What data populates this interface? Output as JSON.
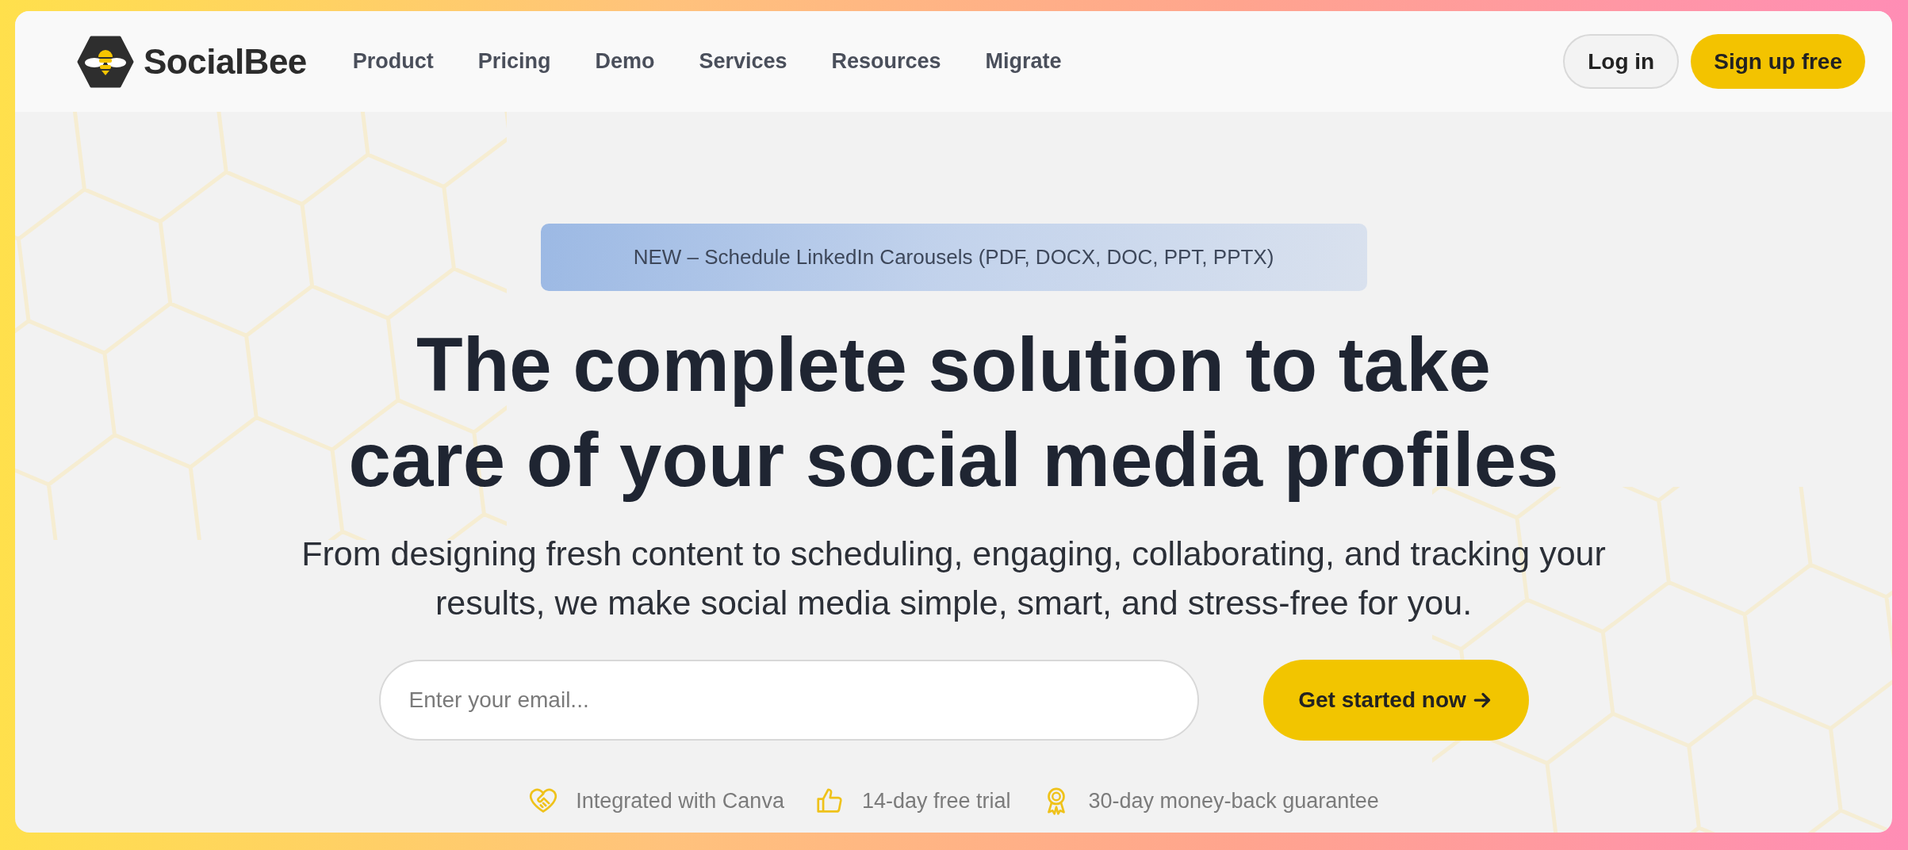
{
  "header": {
    "brand": "SocialBee",
    "nav": [
      "Product",
      "Pricing",
      "Demo",
      "Services",
      "Resources",
      "Migrate"
    ],
    "buttons": [
      {
        "label": "Log in",
        "kind": "secondary"
      },
      {
        "label": "Sign up free",
        "kind": "primary"
      }
    ]
  },
  "hero": {
    "badge": "NEW – Schedule LinkedIn Carousels (PDF, DOCX, DOC, PPT, PPTX)",
    "title": "The complete solution to take care of your social media profiles",
    "subtitle": "From designing fresh content to scheduling, engaging, collaborating, and tracking your results, we make social media simple, smart, and stress-free for you.",
    "signup": {
      "placeholder": "Enter your email...",
      "button": "Get started now"
    },
    "features": [
      {
        "kind": "integration",
        "text": "Integrated with Canva"
      },
      {
        "kind": "trial",
        "text": "14-day free trial"
      },
      {
        "kind": "guarantee",
        "text": "30-day money-back guarantee"
      }
    ]
  }
}
